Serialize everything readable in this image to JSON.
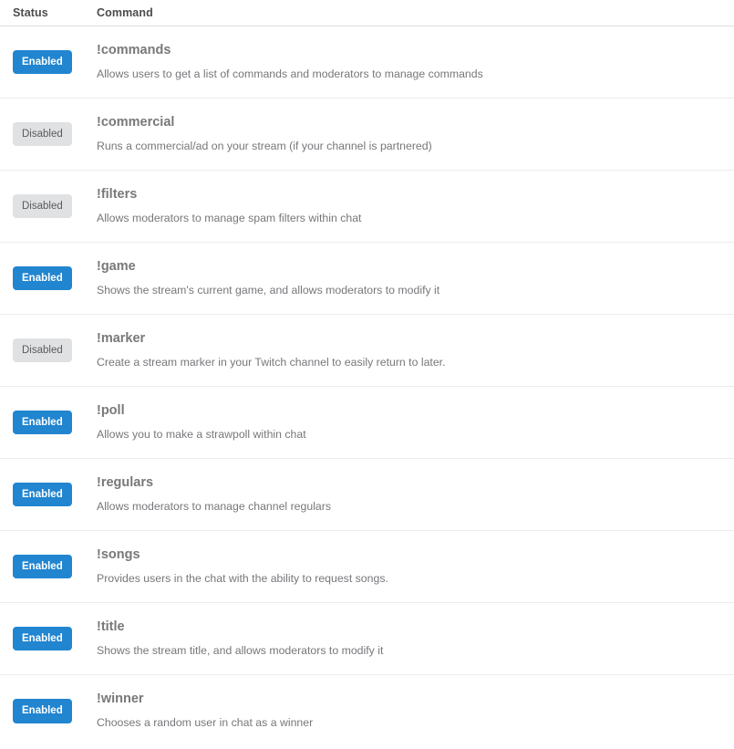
{
  "table": {
    "columns": {
      "status": "Status",
      "command": "Command"
    },
    "status_labels": {
      "enabled": "Enabled",
      "disabled": "Disabled"
    },
    "colors": {
      "enabled_badge_bg": "#2185d0",
      "enabled_badge_text": "#ffffff",
      "disabled_badge_bg": "#e0e1e2",
      "disabled_badge_text": "#5b5b5c",
      "header_text": "#4c4c4d",
      "command_name_text": "#77787a",
      "command_desc_text": "#76777a",
      "row_divider": "#ececec",
      "header_divider": "#dededf",
      "page_background": "#ffffff"
    },
    "rows": [
      {
        "status": "Enabled",
        "name": "!commands",
        "description": "Allows users to get a list of commands and moderators to manage commands"
      },
      {
        "status": "Disabled",
        "name": "!commercial",
        "description": "Runs a commercial/ad on your stream (if your channel is partnered)"
      },
      {
        "status": "Disabled",
        "name": "!filters",
        "description": "Allows moderators to manage spam filters within chat"
      },
      {
        "status": "Enabled",
        "name": "!game",
        "description": "Shows the stream's current game, and allows moderators to modify it"
      },
      {
        "status": "Disabled",
        "name": "!marker",
        "description": "Create a stream marker in your Twitch channel to easily return to later."
      },
      {
        "status": "Enabled",
        "name": "!poll",
        "description": "Allows you to make a strawpoll within chat"
      },
      {
        "status": "Enabled",
        "name": "!regulars",
        "description": "Allows moderators to manage channel regulars"
      },
      {
        "status": "Enabled",
        "name": "!songs",
        "description": "Provides users in the chat with the ability to request songs."
      },
      {
        "status": "Enabled",
        "name": "!title",
        "description": "Shows the stream title, and allows moderators to modify it"
      },
      {
        "status": "Enabled",
        "name": "!winner",
        "description": "Chooses a random user in chat as a winner"
      }
    ]
  }
}
